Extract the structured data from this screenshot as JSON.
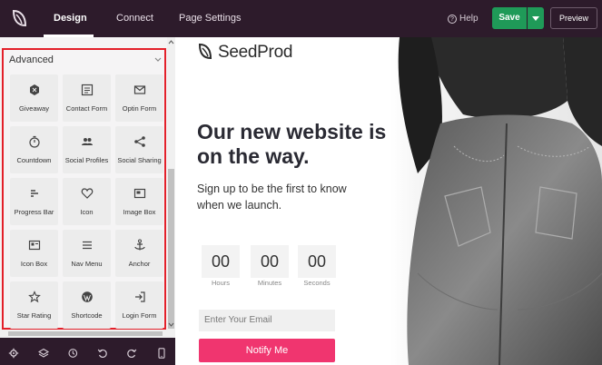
{
  "topbar": {
    "tabs": [
      {
        "label": "Design"
      },
      {
        "label": "Connect"
      },
      {
        "label": "Page Settings"
      }
    ],
    "help_label": "Help",
    "save_label": "Save",
    "preview_label": "Preview"
  },
  "sidebar": {
    "section_title": "Advanced",
    "blocks": [
      {
        "label": "Giveaway",
        "icon": "giveaway-icon"
      },
      {
        "label": "Contact Form",
        "icon": "contact-form-icon"
      },
      {
        "label": "Optin Form",
        "icon": "envelope-icon"
      },
      {
        "label": "Countdown",
        "icon": "stopwatch-icon"
      },
      {
        "label": "Social Profiles",
        "icon": "users-icon"
      },
      {
        "label": "Social Sharing",
        "icon": "share-icon"
      },
      {
        "label": "Progress Bar",
        "icon": "progress-bar-icon"
      },
      {
        "label": "Icon",
        "icon": "heart-icon"
      },
      {
        "label": "Image Box",
        "icon": "image-box-icon"
      },
      {
        "label": "Icon Box",
        "icon": "icon-box-icon"
      },
      {
        "label": "Nav Menu",
        "icon": "menu-icon"
      },
      {
        "label": "Anchor",
        "icon": "anchor-icon"
      },
      {
        "label": "Star Rating",
        "icon": "star-icon"
      },
      {
        "label": "Shortcode",
        "icon": "wordpress-icon"
      },
      {
        "label": "Login Form",
        "icon": "login-icon"
      }
    ]
  },
  "canvas": {
    "brand": "SeedProd",
    "headline": "Our new website is on the way.",
    "subline": "Sign up to be the first to know when we launch.",
    "countdown": [
      {
        "value": "00",
        "label": "Hours"
      },
      {
        "value": "00",
        "label": "Minutes"
      },
      {
        "value": "00",
        "label": "Seconds"
      }
    ],
    "email_placeholder": "Enter Your Email",
    "notify_label": "Notify Me"
  },
  "colors": {
    "topbar_bg": "#2d1b2b",
    "save_green": "#1f9a58",
    "notify_pink": "#f0356f",
    "highlight_red": "#e3202a"
  }
}
